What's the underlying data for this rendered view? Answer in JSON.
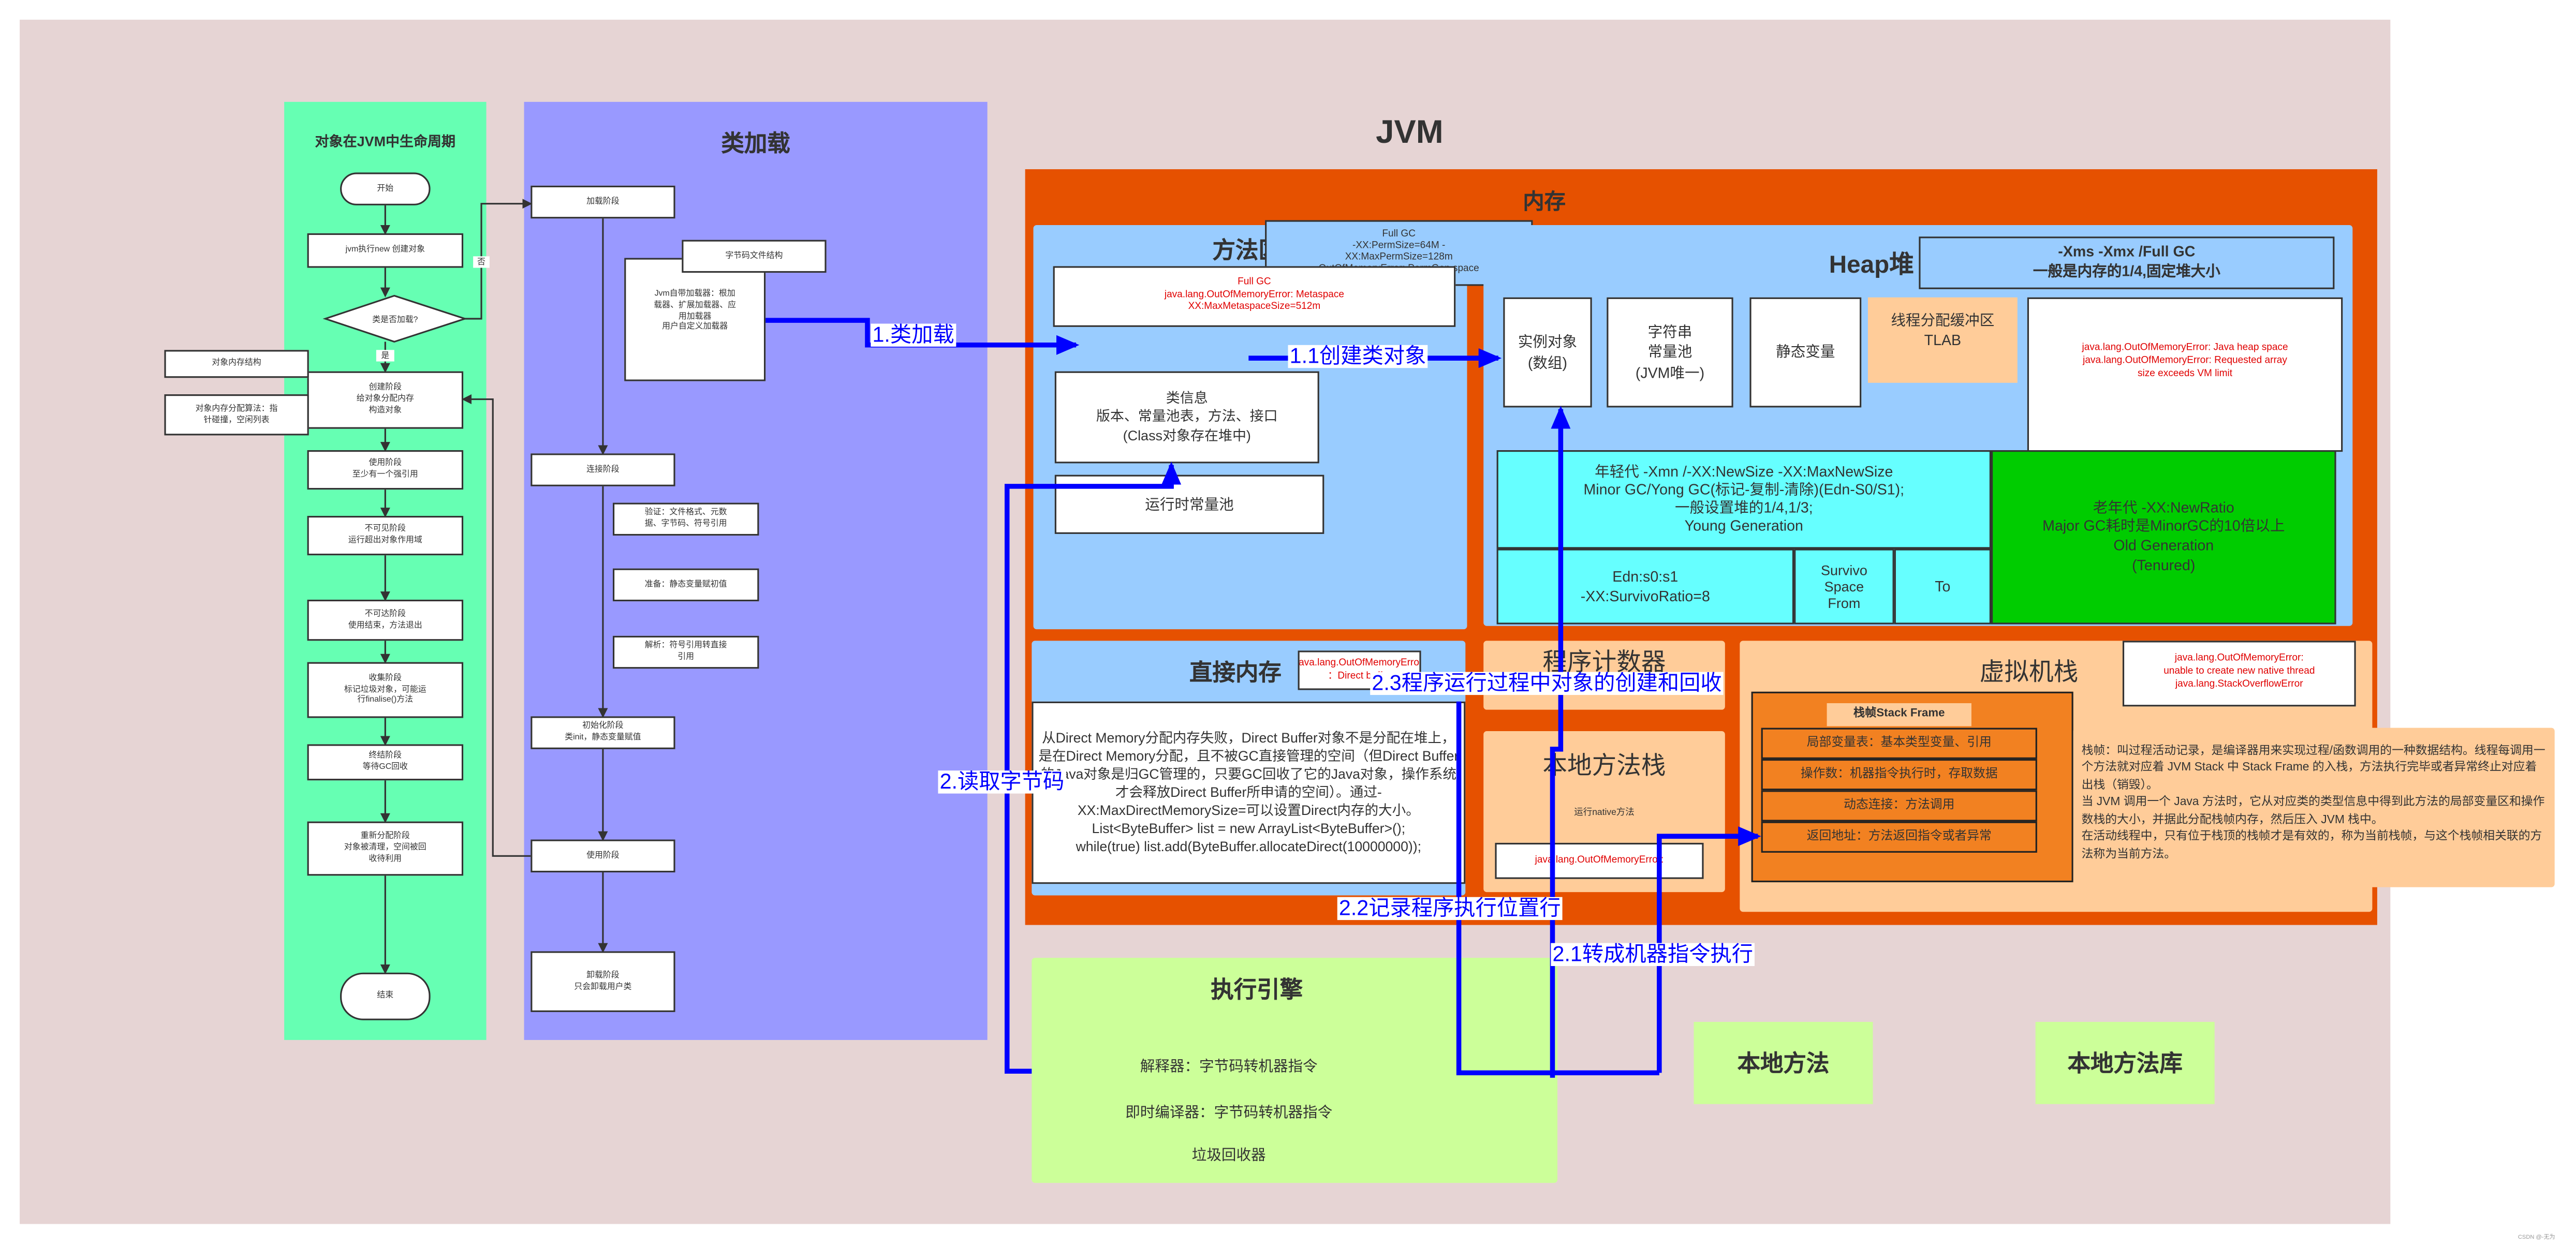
{
  "colors": {
    "background": "#e6d4d4",
    "lifecycle_panel": "#66ffb3",
    "classload_panel": "#9999ff",
    "memory": "#e65100",
    "light_blue": "#99ccff",
    "peach": "#ffcc99",
    "young": "#66ffff",
    "old": "#00cc00",
    "stack_frame": "#f28121",
    "engine": "#ccff99",
    "arrow": "#0000ff",
    "error_text": "#e00000"
  },
  "lifecycle": {
    "title": "对象在JVM中生命周期",
    "start": "开始",
    "new_object": "jvm执行new 创建对象",
    "decision": "类是否加载?",
    "yes": "是",
    "no": "否",
    "stages": [
      "创建阶段\n给对象分配内存\n构造对象",
      "使用阶段\n至少有一个强引用",
      "不可见阶段\n运行超出对象作用域",
      "不可达阶段\n使用结束，方法退出",
      "收集阶段\n标记垃圾对象，可能运\n行finalise()方法",
      "终结阶段\n等待GC回收",
      "重新分配阶段\n对象被清理，空间被回\n收待利用"
    ],
    "end": "结束",
    "memory_structure": "对象内存结构",
    "allocation": "对象内存分配算法：指\n针碰撞，空闲列表"
  },
  "classload": {
    "title": "类加载",
    "loading": "加载阶段",
    "bytecode": "字节码文件结构",
    "loaders": "Jvm自带加载器：根加\n载器、扩展加载器、应\n用加载器\n用户自定义加载器",
    "linking": "连接阶段",
    "verify": "验证：文件格式、元数\n据、字节码、符号引用",
    "prepare": "准备：静态变量赋初值",
    "resolve": "解析：符号引用转直接\n引用",
    "init": "初始化阶段\n类init，静态变量赋值",
    "using": "使用阶段",
    "unload": "卸载阶段\n只会卸载用户类"
  },
  "jvm": {
    "title": "JVM",
    "memory_title": "内存",
    "method_area": {
      "title": "方法区",
      "permgen": "Full GC\n-XX:PermSize=64M -\nXX:MaxPermSize=128m\nOutOfMemoryError:   PermGen space",
      "metaspace": "Full GC\njava.lang.OutOfMemoryError: Metaspace\nXX:MaxMetaspaceSize=512m",
      "class_info": "类信息\n版本、常量池表，方法、接口\n(Class对象存在堆中)",
      "runtime_pool": "运行时常量池"
    },
    "heap": {
      "title": "Heap堆",
      "size": "-Xms -Xmx /Full GC\n一般是内存的1/4,固定堆大小",
      "instance": "实例对象\n(数组)",
      "string_pool": "字符串\n常量池\n(JVM唯一)",
      "static_vars": "静态变量",
      "tlab": "线程分配缓冲区\nTLAB",
      "oom": "java.lang.OutOfMemoryError: Java heap space\njava.lang.OutOfMemoryError: Requested array\nsize exceeds VM limit",
      "young": "年轻代   -Xmn   /-XX:NewSize -XX:MaxNewSize\nMinor GC/Yong GC(标记-复制-清除)(Edn-S0/S1);\n一般设置堆的1/4,1/3;\nYoung Generation",
      "eden": "Edn:s0:s1\n-XX:SurvivoRatio=8",
      "from": "Survivo\nSpace\nFrom",
      "to": "To",
      "old": "老年代  -XX:NewRatio\nMajor GC耗时是MinorGC的10倍以上\nOld Generation\n(Tenured)"
    },
    "direct": {
      "title": "直接内存",
      "oom": "java.lang.OutOfMemoryError\n：Direct buffer",
      "text": "从Direct Memory分配内存失败，Direct Buffer对象不是分配在堆上，是在Direct Memory分配，且不被GC直接管理的空间（但Direct Buffer的Java对象是归GC管理的，只要GC回收了它的Java对象，操作系统才会释放Direct Buffer所申请的空间）。通过-XX:MaxDirectMemorySize=可以设置Direct内存的大小。\nList<ByteBuffer> list = new ArrayList<ByteBuffer>();\nwhile(true) list.add(ByteBuffer.allocateDirect(10000000));"
    },
    "pc": {
      "title": "程序计数器"
    },
    "native_stack": {
      "title": "本地方法栈",
      "desc": "运行native方法",
      "oom": "java.lang.OutOfMemoryError:"
    },
    "vm_stack": {
      "title": "虚拟机栈",
      "oom": "java.lang.OutOfMemoryError:\nunable to create new native thread\njava.lang.StackOverflowError",
      "frame_title": "栈帧Stack Frame",
      "frame_rows": [
        "局部变量表：基本类型变量、引用",
        "操作数：机器指令执行时，存取数据",
        "动态连接：方法调用",
        "返回地址：方法返回指令或者异常"
      ],
      "note": "栈帧：叫过程活动记录，是编译器用来实现过程/函数调用的一种数据结构。线程每调用一个方法就对应着 JVM Stack 中 Stack Frame 的入栈，方法执行完毕或者异常终止对应着出栈（销毁）。\n当 JVM 调用一个 Java 方法时，它从对应类的类型信息中得到此方法的局部变量区和操作数栈的大小，并据此分配栈帧内存，然后压入 JVM 栈中。\n在活动线程中，只有位于栈顶的栈帧才是有效的，称为当前栈帧，与这个栈帧相关联的方法称为当前方法。"
    }
  },
  "engine": {
    "title": "执行引擎",
    "items": [
      "解释器：字节码转机器指令",
      "即时编译器：字节码转机器指令",
      "垃圾回收器"
    ]
  },
  "native_method": "本地方法",
  "native_lib": "本地方法库",
  "arrows": {
    "a1": "1.类加载",
    "a11": "1.1创建类对象",
    "a2": "2.读取字节码",
    "a21": "2.1转成机器指令执行",
    "a22": "2.2记录程序执行位置行",
    "a23": "2.3程序运行过程中对象的创建和回收"
  },
  "watermark": "CSDN @-无为"
}
